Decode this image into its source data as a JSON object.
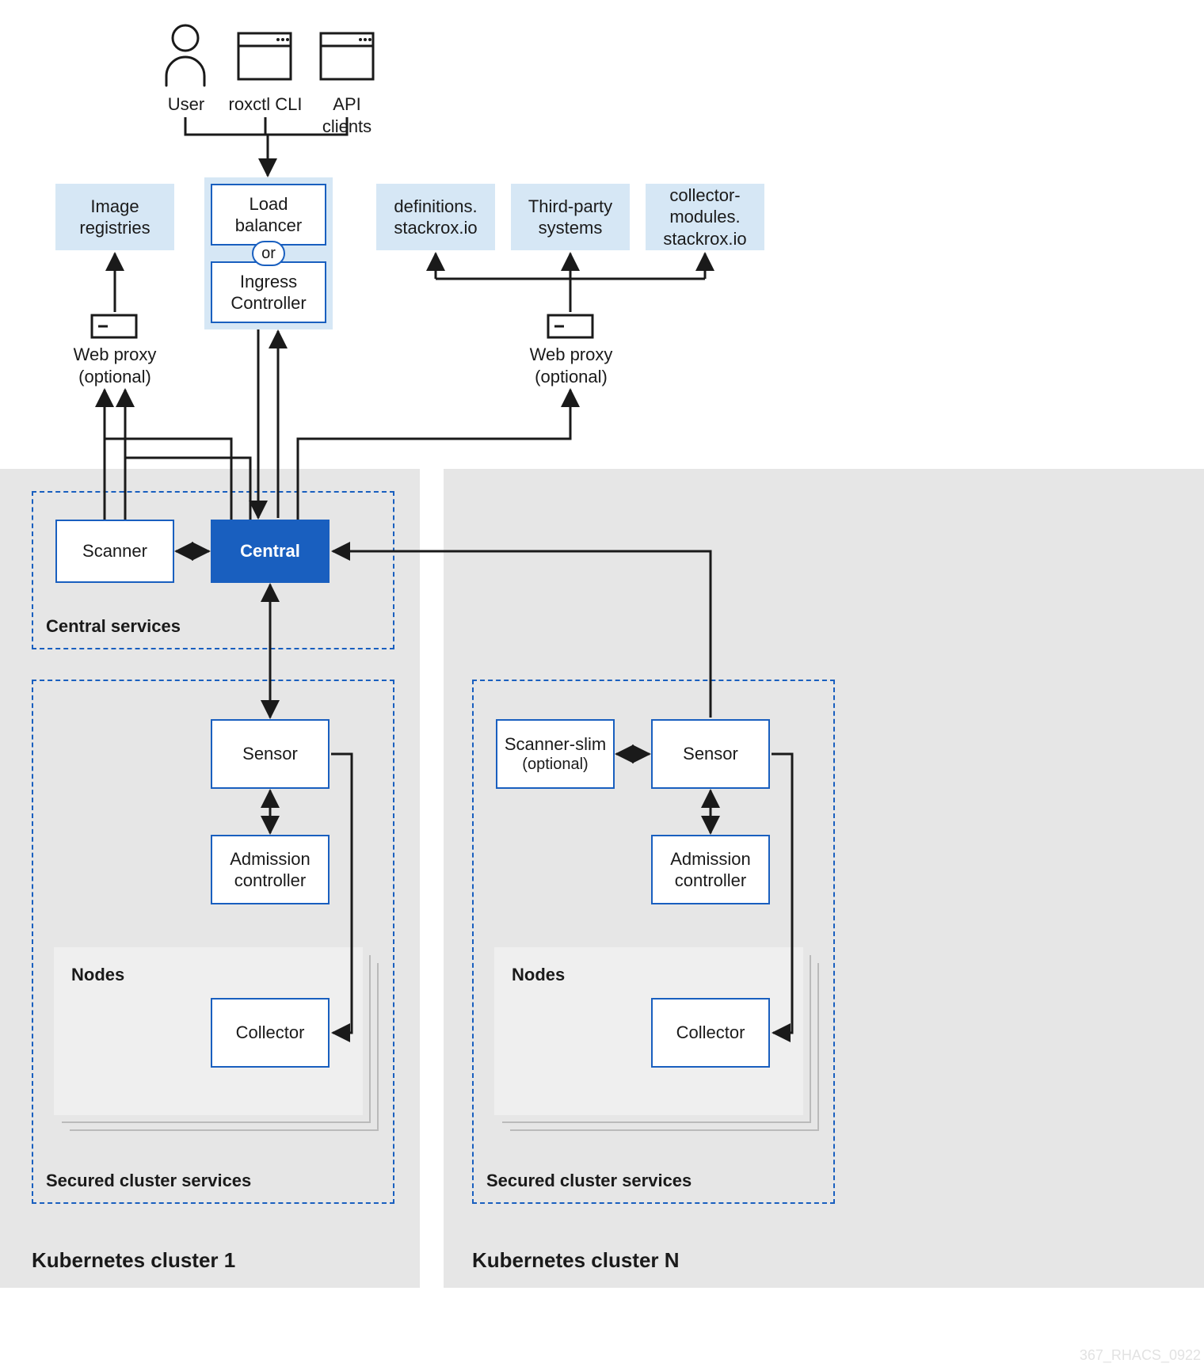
{
  "top": {
    "user": "User",
    "roxctl": "roxctl CLI",
    "api_clients": "API clients"
  },
  "row2": {
    "image_registries": "Image\nregistries",
    "load_balancer": "Load\nbalancer",
    "or": "or",
    "ingress_controller": "Ingress\nController",
    "definitions": "definitions.\nstackrox.io",
    "third_party": "Third-party\nsystems",
    "collector_modules": "collector-\nmodules.\nstackrox.io"
  },
  "webproxy": {
    "label": "Web proxy",
    "optional": "(optional)"
  },
  "cluster1": {
    "title": "Kubernetes cluster 1",
    "central_services": "Central services",
    "scanner": "Scanner",
    "central": "Central",
    "sensor": "Sensor",
    "admission": "Admission\ncontroller",
    "collector": "Collector",
    "nodes": "Nodes",
    "secured": "Secured cluster services"
  },
  "clusterN": {
    "title": "Kubernetes cluster N",
    "scanner_slim": "Scanner-slim",
    "scanner_slim_opt": "(optional)",
    "sensor": "Sensor",
    "admission": "Admission\ncontroller",
    "collector": "Collector",
    "nodes": "Nodes",
    "secured": "Secured cluster services"
  },
  "watermark": "367_RHACS_0922"
}
